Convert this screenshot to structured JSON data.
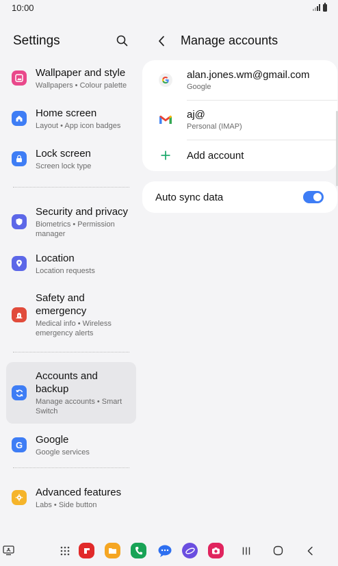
{
  "status_bar": {
    "time": "10:00"
  },
  "settings": {
    "title": "Settings",
    "items": [
      {
        "id": "wallpaper",
        "label": "Wallpaper and style",
        "sub": "Wallpapers  •  Colour palette",
        "icon": "wallpaper-icon",
        "color": "#e9488b"
      },
      {
        "id": "home",
        "label": "Home screen",
        "sub": "Layout  •  App icon badges",
        "icon": "home-icon",
        "color": "#3e7df5"
      },
      {
        "id": "lock",
        "label": "Lock screen",
        "sub": "Screen lock type",
        "icon": "lock-icon",
        "color": "#3e7df5"
      },
      {
        "id": "security",
        "label": "Security and privacy",
        "sub": "Biometrics  •  Permission manager",
        "icon": "shield-icon",
        "color": "#5c67e8"
      },
      {
        "id": "location",
        "label": "Location",
        "sub": "Location requests",
        "icon": "location-pin-icon",
        "color": "#5c67e8"
      },
      {
        "id": "safety",
        "label": "Safety and emergency",
        "sub": "Medical info  •  Wireless emergency alerts",
        "icon": "emergency-icon",
        "color": "#e14b3b"
      },
      {
        "id": "accounts",
        "label": "Accounts and backup",
        "sub": "Manage accounts  •  Smart Switch",
        "icon": "sync-icon",
        "color": "#3e7df5"
      },
      {
        "id": "google",
        "label": "Google",
        "sub": "Google services",
        "icon": "google-icon",
        "color": "#3e7df5"
      },
      {
        "id": "advanced",
        "label": "Advanced features",
        "sub": "Labs  •  Side button",
        "icon": "advanced-features-icon",
        "color": "#f5b42a"
      }
    ]
  },
  "manage_accounts": {
    "title": "Manage accounts",
    "accounts": [
      {
        "name": "alan.jones.wm@gmail.com",
        "type": "Google",
        "icon": "google-g-icon"
      },
      {
        "name": "aj@",
        "type": "Personal (IMAP)",
        "icon": "gmail-icon"
      }
    ],
    "add_account": "Add account",
    "auto_sync": {
      "label": "Auto sync data",
      "enabled": true
    }
  }
}
